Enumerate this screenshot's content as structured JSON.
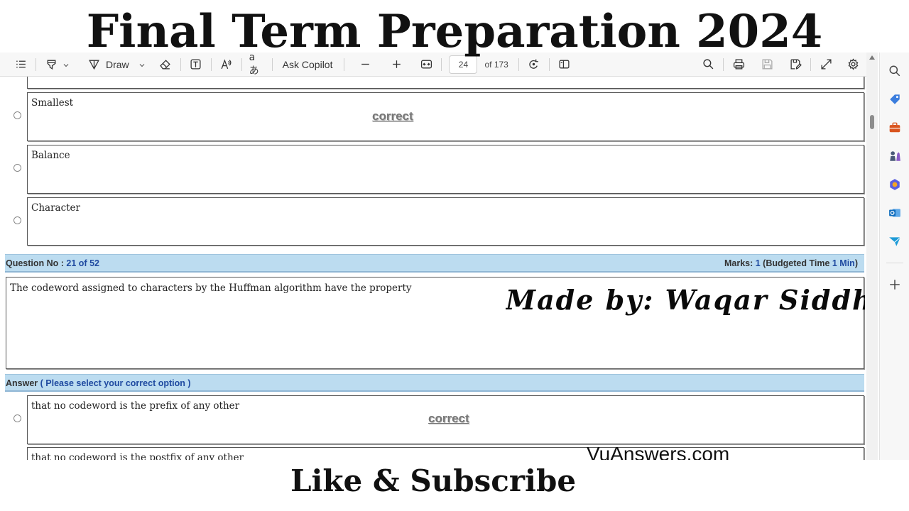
{
  "overlay": {
    "title": "Final Term Preparation 2024",
    "footer": "Like & Subscribe",
    "author_watermark": "Made by: Waqar Siddhu",
    "site_watermark": "VuAnswers.com"
  },
  "toolbar": {
    "draw_label": "Draw",
    "ask_copilot_label": "Ask Copilot",
    "page_current": "24",
    "page_total": "of 173"
  },
  "document": {
    "prev_options": [
      {
        "text": "Smallest",
        "correct": "correct"
      },
      {
        "text": "Balance",
        "correct": ""
      },
      {
        "text": "Character",
        "correct": ""
      }
    ],
    "question": {
      "label": "Question No : ",
      "number": "21 of 52",
      "marks_label": "Marks: ",
      "marks_value": "1",
      "budget_open": " (Budgeted Time ",
      "budget_value": "1 Min",
      "budget_close": ")",
      "text": "The codeword assigned to characters by the Huffman algorithm have the property"
    },
    "answer": {
      "label": "Answer ",
      "instruction": "( Please select your correct option )"
    },
    "options": [
      {
        "text": "that no codeword is the prefix of any other",
        "correct": "correct"
      },
      {
        "text": "that no codeword is the postfix of any other",
        "correct": ""
      }
    ]
  },
  "icons": {
    "toolbar": [
      "contents-icon",
      "highlight-icon",
      "draw-icon",
      "eraser-icon",
      "text-box-icon",
      "read-aloud-icon",
      "translate-icon",
      "zoom-out-icon",
      "zoom-in-icon",
      "fit-width-icon",
      "rotate-icon",
      "page-view-icon",
      "search-icon",
      "print-icon",
      "save-icon",
      "save-as-icon",
      "fullscreen-icon",
      "settings-icon"
    ],
    "sidebar": [
      "search-icon",
      "tag-icon",
      "briefcase-icon",
      "chess-icon",
      "copilot-icon",
      "outlook-icon",
      "send-icon",
      "add-icon"
    ]
  }
}
